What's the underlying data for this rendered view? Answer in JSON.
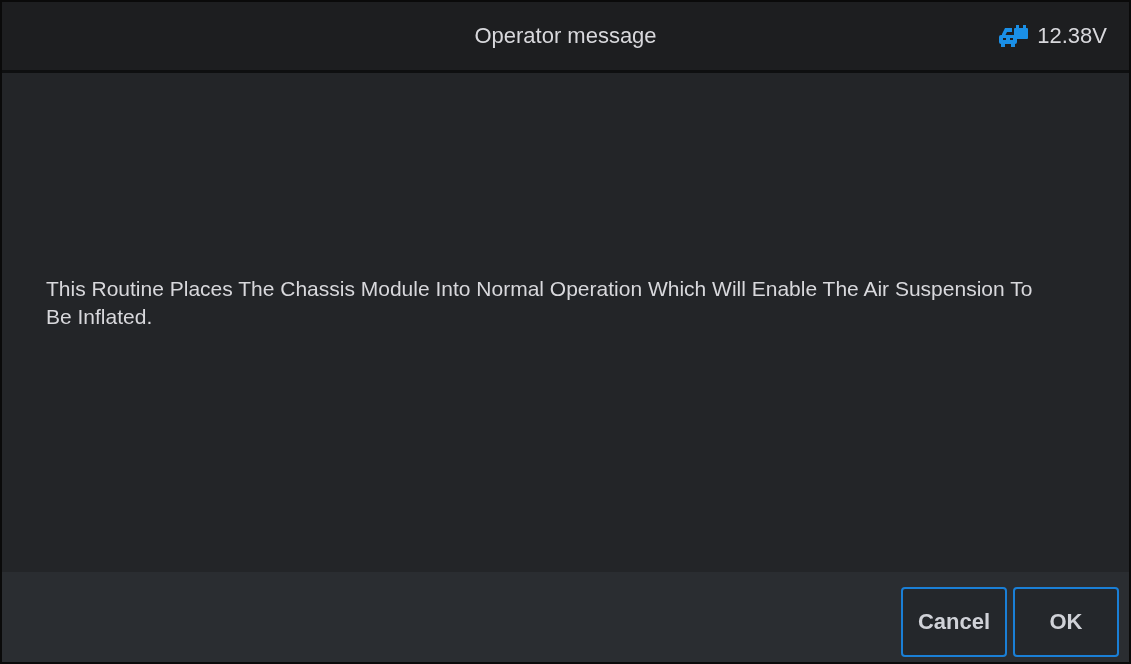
{
  "header": {
    "title": "Operator message",
    "voltage": "12.38V"
  },
  "message": "This Routine Places The Chassis Module Into Normal Operation Which Will Enable The Air Suspension To Be Inflated.",
  "buttons": [
    {
      "label": "Cancel"
    },
    {
      "label": "OK"
    }
  ]
}
